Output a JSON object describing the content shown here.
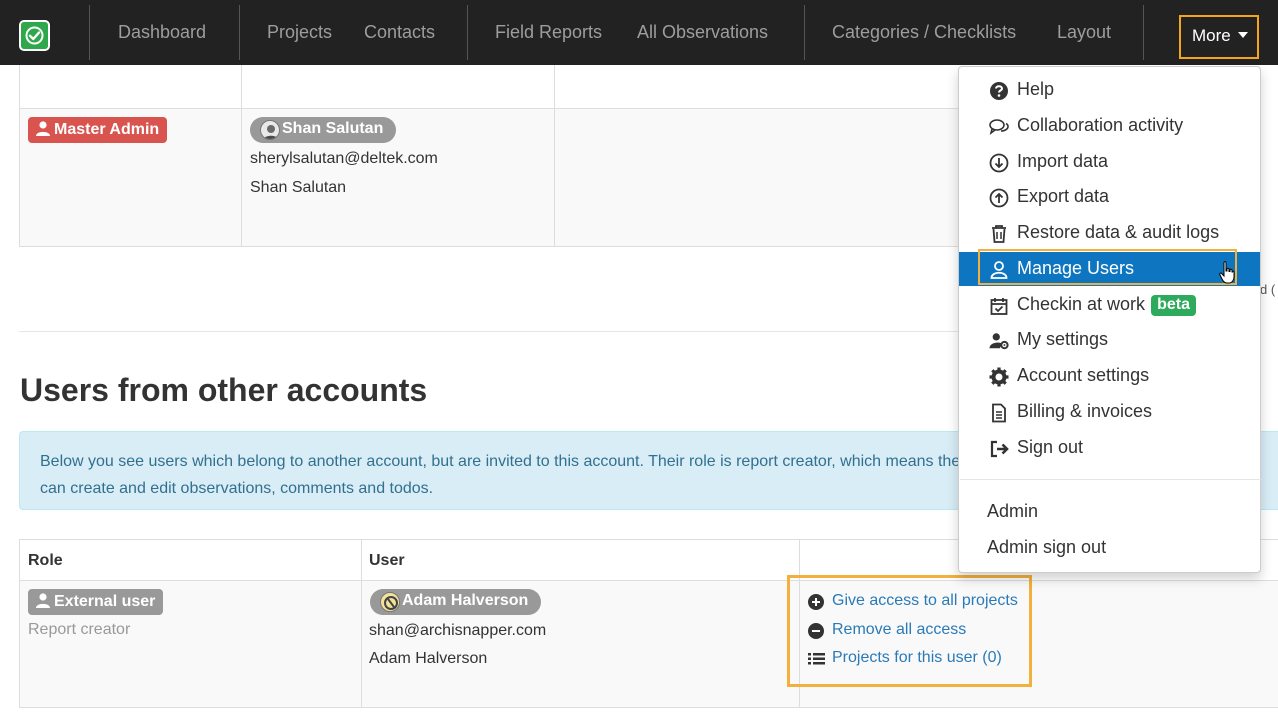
{
  "navbar": {
    "items": [
      "Dashboard",
      "Projects",
      "Contacts",
      "Field Reports",
      "All Observations",
      "Categories / Checklists",
      "Layout"
    ],
    "more_label": "More",
    "accent_color": "#f4a51c"
  },
  "upper_table": {
    "row": {
      "role": "Master Admin",
      "user_name": "Shan Salutan",
      "email": "sherylsalutan@deltek.com",
      "display_name": "Shan Salutan"
    }
  },
  "external_section": {
    "title": "Users from other accounts",
    "info": "Below you see users which belong to another account, but are invited to this account. Their role is report creator, which means they can create and edit observations, comments and todos.",
    "headers": {
      "role": "Role",
      "user": "User"
    },
    "row": {
      "role": "External user",
      "role_sub": "Report creator",
      "user_name": "Adam Halverson",
      "email": "shan@archisnapper.com",
      "display_name": "Adam Halverson",
      "actions": [
        "Give access to all projects",
        "Remove all access",
        "Projects for this user (0)"
      ]
    }
  },
  "more_menu": {
    "items": [
      {
        "label": "Help",
        "icon": "question-circle-icon"
      },
      {
        "label": "Collaboration activity",
        "icon": "comments-icon"
      },
      {
        "label": "Import data",
        "icon": "arrow-down-circle-icon"
      },
      {
        "label": "Export data",
        "icon": "arrow-up-circle-icon"
      },
      {
        "label": "Restore data & audit logs",
        "icon": "trash-icon"
      },
      {
        "label": "Manage Users",
        "icon": "user-icon",
        "active": true
      },
      {
        "label": "Checkin at work",
        "icon": "calendar-check-icon",
        "badge": "beta"
      },
      {
        "label": "My settings",
        "icon": "user-gear-icon"
      },
      {
        "label": "Account settings",
        "icon": "gear-icon"
      },
      {
        "label": "Billing & invoices",
        "icon": "file-icon"
      },
      {
        "label": "Sign out",
        "icon": "sign-out-icon"
      }
    ],
    "admin_items": [
      "Admin",
      "Admin sign out"
    ],
    "active_color": "#0e76c0",
    "badge_color": "#2eaa5c"
  }
}
